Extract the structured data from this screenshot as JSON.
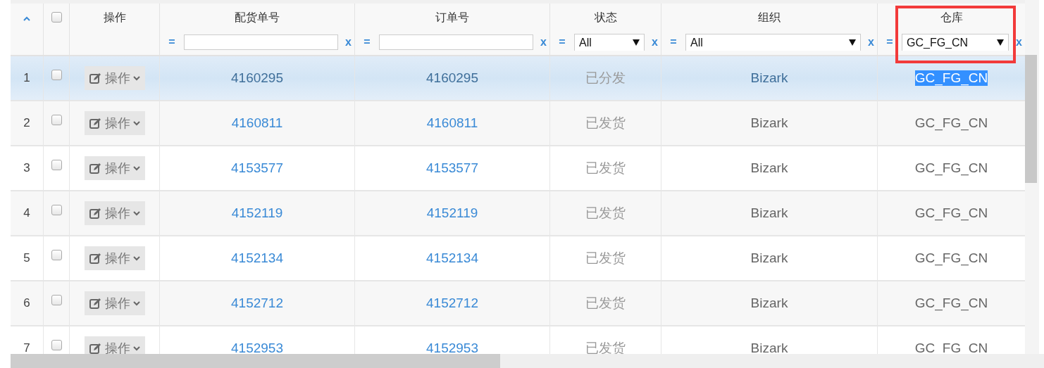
{
  "table": {
    "header_checkbox": {
      "checked": false
    },
    "columns": [
      {
        "label": "操作",
        "filter": {
          "kind": "none"
        }
      },
      {
        "label": "配货单号",
        "filter": {
          "kind": "text",
          "operator": "=",
          "clear": "x"
        }
      },
      {
        "label": "订单号",
        "filter": {
          "kind": "text",
          "operator": "=",
          "clear": "x"
        }
      },
      {
        "label": "状态",
        "filter": {
          "kind": "select",
          "operator": "=",
          "value": "All",
          "clear": "x"
        }
      },
      {
        "label": "组织",
        "filter": {
          "kind": "select",
          "operator": "=",
          "value": "All",
          "clear": "x"
        }
      },
      {
        "label": "仓库",
        "filter": {
          "kind": "select",
          "operator": "=",
          "value": "GC_FG_CN",
          "clear": "x",
          "outlined": true
        }
      }
    ],
    "rows": [
      {
        "num": "1",
        "checked": false,
        "selected": true,
        "action": "操作",
        "shipment_no": "4160295",
        "order_no": "4160295",
        "status": "已分发",
        "org": "Bizark",
        "warehouse": "GC_FG_CN",
        "warehouse_text_selected": true
      },
      {
        "num": "2",
        "checked": false,
        "selected": false,
        "action": "操作",
        "shipment_no": "4160811",
        "order_no": "4160811",
        "status": "已发货",
        "org": "Bizark",
        "warehouse": "GC_FG_CN",
        "warehouse_text_selected": false
      },
      {
        "num": "3",
        "checked": false,
        "selected": false,
        "action": "操作",
        "shipment_no": "4153577",
        "order_no": "4153577",
        "status": "已发货",
        "org": "Bizark",
        "warehouse": "GC_FG_CN",
        "warehouse_text_selected": false
      },
      {
        "num": "4",
        "checked": false,
        "selected": false,
        "action": "操作",
        "shipment_no": "4152119",
        "order_no": "4152119",
        "status": "已发货",
        "org": "Bizark",
        "warehouse": "GC_FG_CN",
        "warehouse_text_selected": false
      },
      {
        "num": "5",
        "checked": false,
        "selected": false,
        "action": "操作",
        "shipment_no": "4152134",
        "order_no": "4152134",
        "status": "已发货",
        "org": "Bizark",
        "warehouse": "GC_FG_CN",
        "warehouse_text_selected": false
      },
      {
        "num": "6",
        "checked": false,
        "selected": false,
        "action": "操作",
        "shipment_no": "4152712",
        "order_no": "4152712",
        "status": "已发货",
        "org": "Bizark",
        "warehouse": "GC_FG_CN",
        "warehouse_text_selected": false
      },
      {
        "num": "7",
        "checked": false,
        "selected": false,
        "action": "操作",
        "shipment_no": "4152953",
        "order_no": "4152953",
        "status": "已发货",
        "org": "Bizark",
        "warehouse": "GC_FG_CN",
        "warehouse_text_selected": false
      }
    ]
  }
}
